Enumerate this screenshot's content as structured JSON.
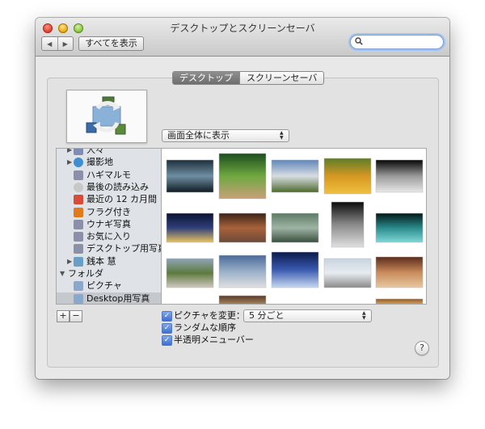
{
  "window": {
    "title": "デスクトップとスクリーンセーバ"
  },
  "toolbar": {
    "back_glyph": "◀",
    "forward_glyph": "▶",
    "show_all_label": "すべてを表示",
    "search_value": "",
    "search_placeholder": ""
  },
  "tabs": [
    {
      "label": "デスクトップ",
      "active": true
    },
    {
      "label": "スクリーンセーバ",
      "active": false
    }
  ],
  "fit_popup": {
    "value": "画面全体に表示",
    "arrows": "▲▼"
  },
  "sidebar": {
    "items": [
      {
        "label": "人々",
        "icon": "faces-icon",
        "level": 1,
        "disclosure": "▶",
        "selected": false
      },
      {
        "label": "撮影地",
        "icon": "globe-icon",
        "level": 1,
        "disclosure": "▶",
        "selected": false
      },
      {
        "label": "ハギマルモ",
        "icon": "album-icon",
        "level": 1,
        "disclosure": "",
        "selected": false
      },
      {
        "label": "最後の読み込み",
        "icon": "import-icon",
        "level": 1,
        "disclosure": "",
        "selected": false
      },
      {
        "label": "最近の 12 カ月間",
        "icon": "calendar-icon",
        "level": 1,
        "disclosure": "",
        "selected": false
      },
      {
        "label": "フラグ付き",
        "icon": "flag-icon",
        "level": 1,
        "disclosure": "",
        "selected": false
      },
      {
        "label": "ウナギ写真",
        "icon": "album-icon",
        "level": 1,
        "disclosure": "",
        "selected": false
      },
      {
        "label": "お気に入り",
        "icon": "album-icon",
        "level": 1,
        "disclosure": "",
        "selected": false
      },
      {
        "label": "デスクトップ用写真",
        "icon": "album-icon",
        "level": 1,
        "disclosure": "",
        "selected": false
      },
      {
        "label": "銭本 慧",
        "icon": "event-icon",
        "level": 1,
        "disclosure": "▶",
        "selected": false
      },
      {
        "label": "フォルダ",
        "icon": "",
        "level": 0,
        "disclosure": "▼",
        "selected": false
      },
      {
        "label": "ピクチャ",
        "icon": "folder-icon",
        "level": 1,
        "disclosure": "",
        "selected": false
      },
      {
        "label": "Desktop用写真",
        "icon": "folder-icon",
        "level": 1,
        "disclosure": "",
        "selected": true
      }
    ]
  },
  "thumbnails": [
    {
      "name": "thumb-dark-sea",
      "colors": [
        "#1c2e3a",
        "#6f8fa3",
        "#0e1a22"
      ]
    },
    {
      "name": "thumb-chipmunk",
      "colors": [
        "#1c4d1e",
        "#6fa840",
        "#c9a07a"
      ]
    },
    {
      "name": "thumb-landscape-sky",
      "colors": [
        "#5f86b8",
        "#d8dde2",
        "#4d6a2f"
      ]
    },
    {
      "name": "thumb-parrot",
      "colors": [
        "#5d7d2a",
        "#d69822",
        "#f0c040"
      ]
    },
    {
      "name": "thumb-dancers",
      "colors": [
        "#050505",
        "#9a9a9a",
        "#e8e8e8"
      ]
    },
    {
      "name": "thumb-night-bay",
      "colors": [
        "#0c1330",
        "#2e3f7a",
        "#e8c460"
      ]
    },
    {
      "name": "thumb-sunset-sea",
      "colors": [
        "#3a2418",
        "#a8623a",
        "#6b4a3a"
      ]
    },
    {
      "name": "thumb-misty-deer",
      "colors": [
        "#5c7a64",
        "#9fb4a4",
        "#3a4f3e"
      ]
    },
    {
      "name": "thumb-waterfall",
      "colors": [
        "#0b0b0b",
        "#8a8a8a",
        "#e0e0e0"
      ]
    },
    {
      "name": "thumb-jellyfish",
      "colors": [
        "#031818",
        "#2a8a8a",
        "#7fd8d8"
      ]
    },
    {
      "name": "thumb-group-field",
      "colors": [
        "#8fa4b8",
        "#5e7a3e",
        "#d0c8c0"
      ]
    },
    {
      "name": "thumb-ship-deck",
      "colors": [
        "#4a6a9a",
        "#9ab0c8",
        "#e0e0e0"
      ]
    },
    {
      "name": "thumb-diatom",
      "colors": [
        "#0a1a4a",
        "#3a5ab0",
        "#c8d8f0"
      ]
    },
    {
      "name": "thumb-seagull",
      "colors": [
        "#c8d4e0",
        "#e8ecf0",
        "#8a8a8a"
      ]
    },
    {
      "name": "thumb-party",
      "colors": [
        "#5a2a1a",
        "#c88a5a",
        "#e8c8a0"
      ]
    },
    {
      "name": "thumb-row4-a",
      "colors": [
        "#5a3a2a",
        "#8a6a4a",
        "#c8a070"
      ]
    },
    {
      "name": "thumb-row4-b",
      "colors": [
        "#8a5a2a",
        "#c89050",
        "#e8c080"
      ]
    }
  ],
  "bottom_controls": {
    "add_label": "+",
    "remove_label": "−",
    "change_picture": {
      "label": "ピクチャを変更：",
      "checked": true,
      "interval": "5 分ごと"
    },
    "random_order": {
      "label": "ランダムな順序",
      "checked": true
    },
    "translucent_menu": {
      "label": "半透明メニューバー",
      "checked": true
    },
    "checkmark": "✓",
    "help_label": "?"
  }
}
